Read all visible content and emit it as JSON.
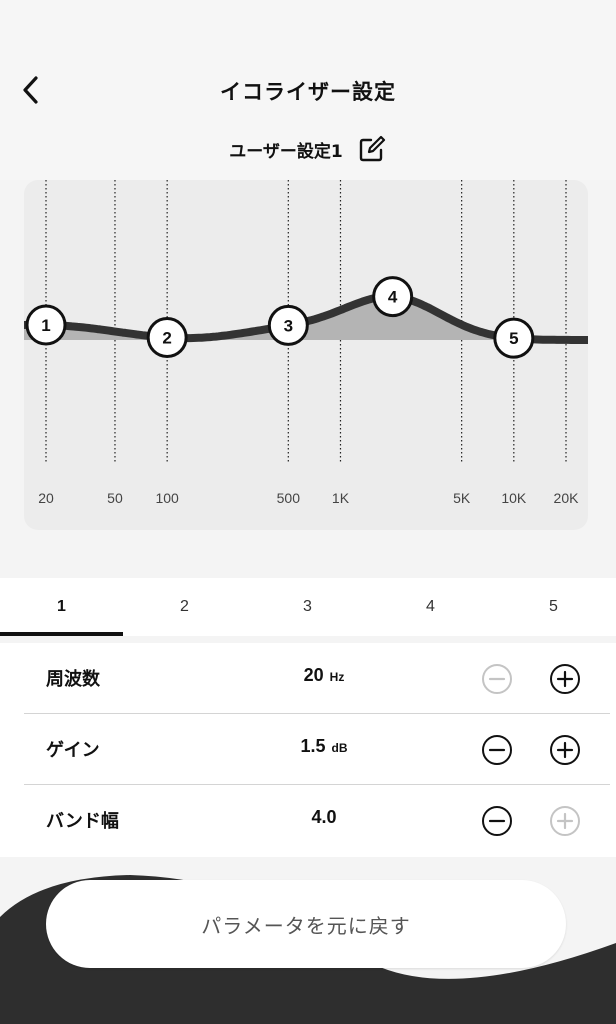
{
  "header": {
    "title": "イコライザー設定",
    "preset_name": "ユーザー設定1"
  },
  "chart_data": {
    "type": "line",
    "x_ticks": [
      "20",
      "50",
      "100",
      "500",
      "1K",
      "5K",
      "10K",
      "20K"
    ],
    "x_scale": "log",
    "bands": [
      {
        "label": "1",
        "freq_hz": 20,
        "gain_db": 1.5
      },
      {
        "label": "2",
        "freq_hz": 100,
        "gain_db": -0.5
      },
      {
        "label": "3",
        "freq_hz": 500,
        "gain_db": 1.0
      },
      {
        "label": "4",
        "freq_hz": 2000,
        "gain_db": 4.0
      },
      {
        "label": "5",
        "freq_hz": 10000,
        "gain_db": 0.0
      }
    ]
  },
  "tabs": [
    "1",
    "2",
    "3",
    "4",
    "5"
  ],
  "active_tab": "1",
  "params": [
    {
      "label": "周波数",
      "value": "20",
      "unit": "Hz",
      "minus_enabled": false,
      "plus_enabled": true
    },
    {
      "label": "ゲイン",
      "value": "1.5",
      "unit": "dB",
      "minus_enabled": true,
      "plus_enabled": true
    },
    {
      "label": "バンド幅",
      "value": "4.0",
      "unit": "",
      "minus_enabled": true,
      "plus_enabled": false
    }
  ],
  "reset_label": "パラメータを元に戻す",
  "colors": {
    "curve": "#333333",
    "fill": "#b4b4b4",
    "disabled": "#c4c4c4",
    "footer": "#2e2e2e"
  }
}
